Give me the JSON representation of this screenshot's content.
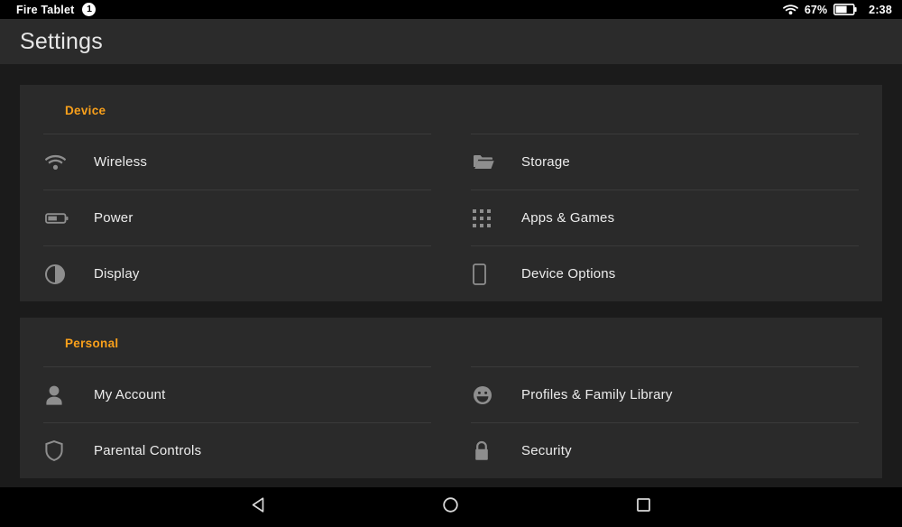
{
  "statusbar": {
    "app_name": "Fire Tablet",
    "notification_count": "1",
    "wifi_icon": "wifi-icon",
    "battery_percent": "67%",
    "battery_icon": "battery-icon",
    "clock": "2:38"
  },
  "header": {
    "title": "Settings"
  },
  "colors": {
    "accent": "#f9a01b",
    "page_background": "#1b1b1b",
    "card_background": "#2a2a2a",
    "divider": "#3a3a3a",
    "label_text": "#ececec",
    "icon": "#8e8e8e"
  },
  "sections": [
    {
      "title": "Device",
      "items": [
        {
          "label": "Wireless",
          "icon": "wifi-icon"
        },
        {
          "label": "Storage",
          "icon": "folder-icon"
        },
        {
          "label": "Power",
          "icon": "battery-icon"
        },
        {
          "label": "Apps & Games",
          "icon": "grid-dots-icon"
        },
        {
          "label": "Display",
          "icon": "brightness-half-icon"
        },
        {
          "label": "Device Options",
          "icon": "tablet-icon"
        }
      ]
    },
    {
      "title": "Personal",
      "items": [
        {
          "label": "My Account",
          "icon": "person-icon"
        },
        {
          "label": "Profiles & Family Library",
          "icon": "smiley-icon"
        },
        {
          "label": "Parental Controls",
          "icon": "shield-icon"
        },
        {
          "label": "Security",
          "icon": "lock-icon"
        }
      ]
    }
  ],
  "navbar": {
    "back": "back-triangle-icon",
    "home": "home-circle-icon",
    "recents": "recents-square-icon"
  }
}
